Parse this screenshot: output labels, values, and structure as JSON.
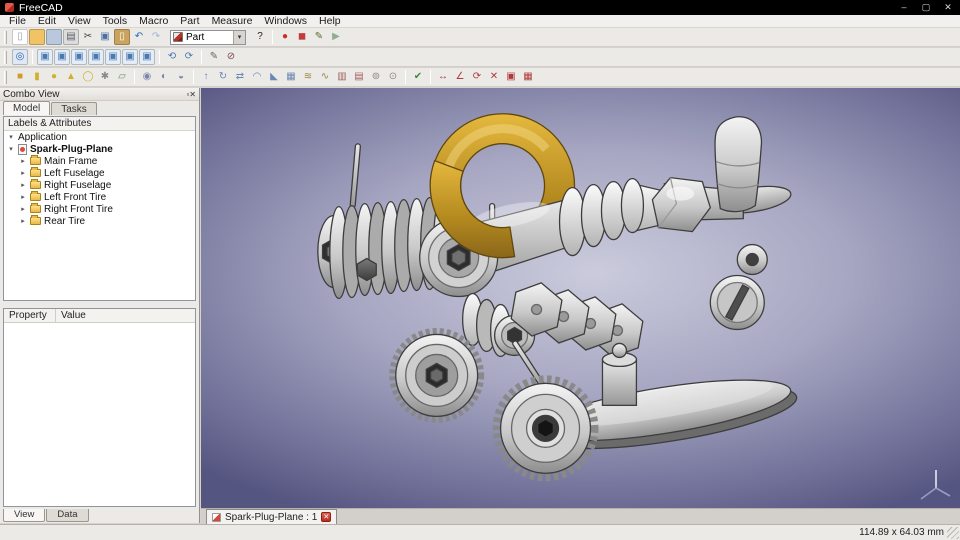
{
  "window": {
    "title": "FreeCAD",
    "controls": [
      {
        "n": "minimize-button",
        "g": "–"
      },
      {
        "n": "maximize-button",
        "g": "▢"
      },
      {
        "n": "close-button",
        "g": "✕"
      }
    ]
  },
  "menubar": [
    "File",
    "Edit",
    "View",
    "Tools",
    "Macro",
    "Part",
    "Measure",
    "Windows",
    "Help"
  ],
  "workbench_selector": {
    "value": "Part",
    "caret": "▾"
  },
  "toolbars": {
    "file": [
      {
        "n": "new-document-icon",
        "g": "▯",
        "fg": "#9aa2ad",
        "bg": "#ffffff"
      },
      {
        "n": "open-folder-icon",
        "g": "",
        "fg": "#7a5c10",
        "bg": "#f0c465"
      },
      {
        "n": "save-icon",
        "g": "",
        "fg": "#35516e",
        "bg": "#b9c8dc"
      },
      {
        "n": "print-icon",
        "g": "▤",
        "fg": "#5a5f66",
        "bg": "#dcdcdc"
      },
      {
        "n": "cut-icon",
        "g": "✂",
        "fg": "#444444",
        "bg": ""
      },
      {
        "n": "copy-icon",
        "g": "▣",
        "fg": "#4a6fa5",
        "bg": ""
      },
      {
        "n": "paste-icon",
        "g": "▯",
        "fg": "#fff8e8",
        "bg": "#caa45f"
      },
      {
        "n": "undo-icon",
        "g": "↶",
        "fg": "#2b66b8",
        "bg": ""
      },
      {
        "n": "redo-icon",
        "g": "↷",
        "fg": "#9fb4d6",
        "bg": ""
      }
    ],
    "macro": [
      {
        "n": "whats-this-icon",
        "g": "?",
        "fg": "#222222",
        "bg": ""
      },
      {
        "sep": true
      },
      {
        "n": "macro-record-icon",
        "g": "●",
        "fg": "#cf2b2b",
        "bg": ""
      },
      {
        "n": "macro-stop-icon",
        "g": "◼",
        "fg": "#c23a3a",
        "bg": ""
      },
      {
        "n": "macro-edit-icon",
        "g": "✎",
        "fg": "#556b2f",
        "bg": ""
      },
      {
        "n": "macro-play-icon",
        "g": "▶",
        "fg": "#8fae8f",
        "bg": ""
      }
    ],
    "view": [
      {
        "n": "fit-all-icon",
        "g": "◎",
        "fg": "#2f5fa3",
        "bg": "#dfe9f6"
      },
      {
        "sep": true
      },
      {
        "n": "isometric-view-icon",
        "g": "▣",
        "fg": "#4a78b0",
        "bg": "#e4ecf6"
      },
      {
        "n": "front-view-icon",
        "g": "▣",
        "fg": "#4a78b0",
        "bg": "#e4ecf6"
      },
      {
        "n": "top-view-icon",
        "g": "▣",
        "fg": "#4a78b0",
        "bg": "#e4ecf6"
      },
      {
        "n": "right-view-icon",
        "g": "▣",
        "fg": "#4a78b0",
        "bg": "#e4ecf6"
      },
      {
        "n": "rear-view-icon",
        "g": "▣",
        "fg": "#4a78b0",
        "bg": "#e4ecf6"
      },
      {
        "n": "bottom-view-icon",
        "g": "▣",
        "fg": "#4a78b0",
        "bg": "#e4ecf6"
      },
      {
        "n": "left-view-icon",
        "g": "▣",
        "fg": "#4a78b0",
        "bg": "#e4ecf6"
      },
      {
        "sep": true
      },
      {
        "n": "rotate-left-icon",
        "g": "⟲",
        "fg": "#4a78b0",
        "bg": ""
      },
      {
        "n": "rotate-right-icon",
        "g": "⟳",
        "fg": "#4a78b0",
        "bg": ""
      },
      {
        "sep": true
      },
      {
        "n": "edit-mode-icon",
        "g": "✎",
        "fg": "#666666",
        "bg": ""
      },
      {
        "n": "draw-style-icon",
        "g": "⊘",
        "fg": "#7a4a4a",
        "bg": ""
      }
    ],
    "part": [
      {
        "n": "box-primitive-icon",
        "g": "■",
        "fg": "#d09a2f",
        "bg": ""
      },
      {
        "n": "cylinder-primitive-icon",
        "g": "▮",
        "fg": "#d0b02f",
        "bg": ""
      },
      {
        "n": "sphere-primitive-icon",
        "g": "●",
        "fg": "#d0b02f",
        "bg": ""
      },
      {
        "n": "cone-primitive-icon",
        "g": "▲",
        "fg": "#d0b02f",
        "bg": ""
      },
      {
        "n": "torus-primitive-icon",
        "g": "◯",
        "fg": "#d0b02f",
        "bg": ""
      },
      {
        "n": "create-primitives-icon",
        "g": "✱",
        "fg": "#888888",
        "bg": ""
      },
      {
        "n": "shape-builder-icon",
        "g": "▱",
        "fg": "#6a8f6a",
        "bg": ""
      },
      {
        "sep": true
      },
      {
        "n": "boolean-union-icon",
        "g": "◉",
        "fg": "#7a86b0",
        "bg": ""
      },
      {
        "n": "boolean-cut-icon",
        "g": "◐",
        "fg": "#7a86b0",
        "bg": ""
      },
      {
        "n": "boolean-intersection-icon",
        "g": "◒",
        "fg": "#7a86b0",
        "bg": ""
      },
      {
        "sep": true
      },
      {
        "n": "extrude-icon",
        "g": "↑",
        "fg": "#6a87b5",
        "bg": ""
      },
      {
        "n": "revolve-icon",
        "g": "↻",
        "fg": "#6a87b5",
        "bg": ""
      },
      {
        "n": "mirror-icon",
        "g": "⇄",
        "fg": "#6a87b5",
        "bg": ""
      },
      {
        "n": "fillet-icon",
        "g": "◠",
        "fg": "#6a87b5",
        "bg": ""
      },
      {
        "n": "chamfer-icon",
        "g": "◣",
        "fg": "#6a87b5",
        "bg": ""
      },
      {
        "n": "ruled-surface-icon",
        "g": "▦",
        "fg": "#6a87b5",
        "bg": ""
      },
      {
        "n": "loft-icon",
        "g": "≋",
        "fg": "#99884a",
        "bg": ""
      },
      {
        "n": "sweep-icon",
        "g": "∿",
        "fg": "#99884a",
        "bg": ""
      },
      {
        "n": "section-icon",
        "g": "▥",
        "fg": "#a06060",
        "bg": ""
      },
      {
        "n": "cross-sections-icon",
        "g": "▤",
        "fg": "#a06060",
        "bg": ""
      },
      {
        "n": "offset-icon",
        "g": "⊚",
        "fg": "#888888",
        "bg": ""
      },
      {
        "n": "thickness-icon",
        "g": "⊙",
        "fg": "#888888",
        "bg": ""
      },
      {
        "sep": true
      },
      {
        "n": "check-geometry-icon",
        "g": "✔",
        "fg": "#3c8a3c",
        "bg": ""
      },
      {
        "sep": true
      },
      {
        "n": "measure-linear-icon",
        "g": "↔",
        "fg": "#b03a3a",
        "bg": ""
      },
      {
        "n": "measure-angular-icon",
        "g": "∠",
        "fg": "#b03a3a",
        "bg": ""
      },
      {
        "n": "measure-refresh-icon",
        "g": "⟳",
        "fg": "#b03a3a",
        "bg": ""
      },
      {
        "n": "measure-clear-icon",
        "g": "✕",
        "fg": "#b03a3a",
        "bg": ""
      },
      {
        "n": "toggle-measure-all-icon",
        "g": "▣",
        "fg": "#b03a3a",
        "bg": ""
      },
      {
        "n": "toggle-measure-3d-icon",
        "g": "▦",
        "fg": "#b03a3a",
        "bg": ""
      }
    ]
  },
  "combo_view": {
    "title": "Combo View",
    "buttons": [
      {
        "n": "panel-float-button",
        "g": "▫"
      },
      {
        "n": "panel-close-button",
        "g": "✕"
      }
    ],
    "tabs": [
      {
        "label": "Model",
        "active": true
      },
      {
        "label": "Tasks",
        "active": false
      }
    ],
    "tree_header": "Labels & Attributes",
    "tree": {
      "open_glyph": "▾",
      "closed_glyph": "▸",
      "root_label": "Application",
      "doc_label": "Spark-Plug-Plane",
      "groups": [
        "Main Frame",
        "Left Fuselage",
        "Right Fuselage",
        "Left Front Tire",
        "Right Front Tire",
        "Rear Tire"
      ]
    },
    "property_panel": {
      "columns": [
        "Property",
        "Value"
      ]
    },
    "bottom_tabs": [
      {
        "label": "View",
        "active": true
      },
      {
        "label": "Data",
        "active": false
      }
    ]
  },
  "viewport": {
    "doc_tab_label": "Spark-Plug-Plane : 1",
    "close_glyph": "✕"
  },
  "statusbar": {
    "dimensions": "114.89 x 64.03 mm"
  }
}
